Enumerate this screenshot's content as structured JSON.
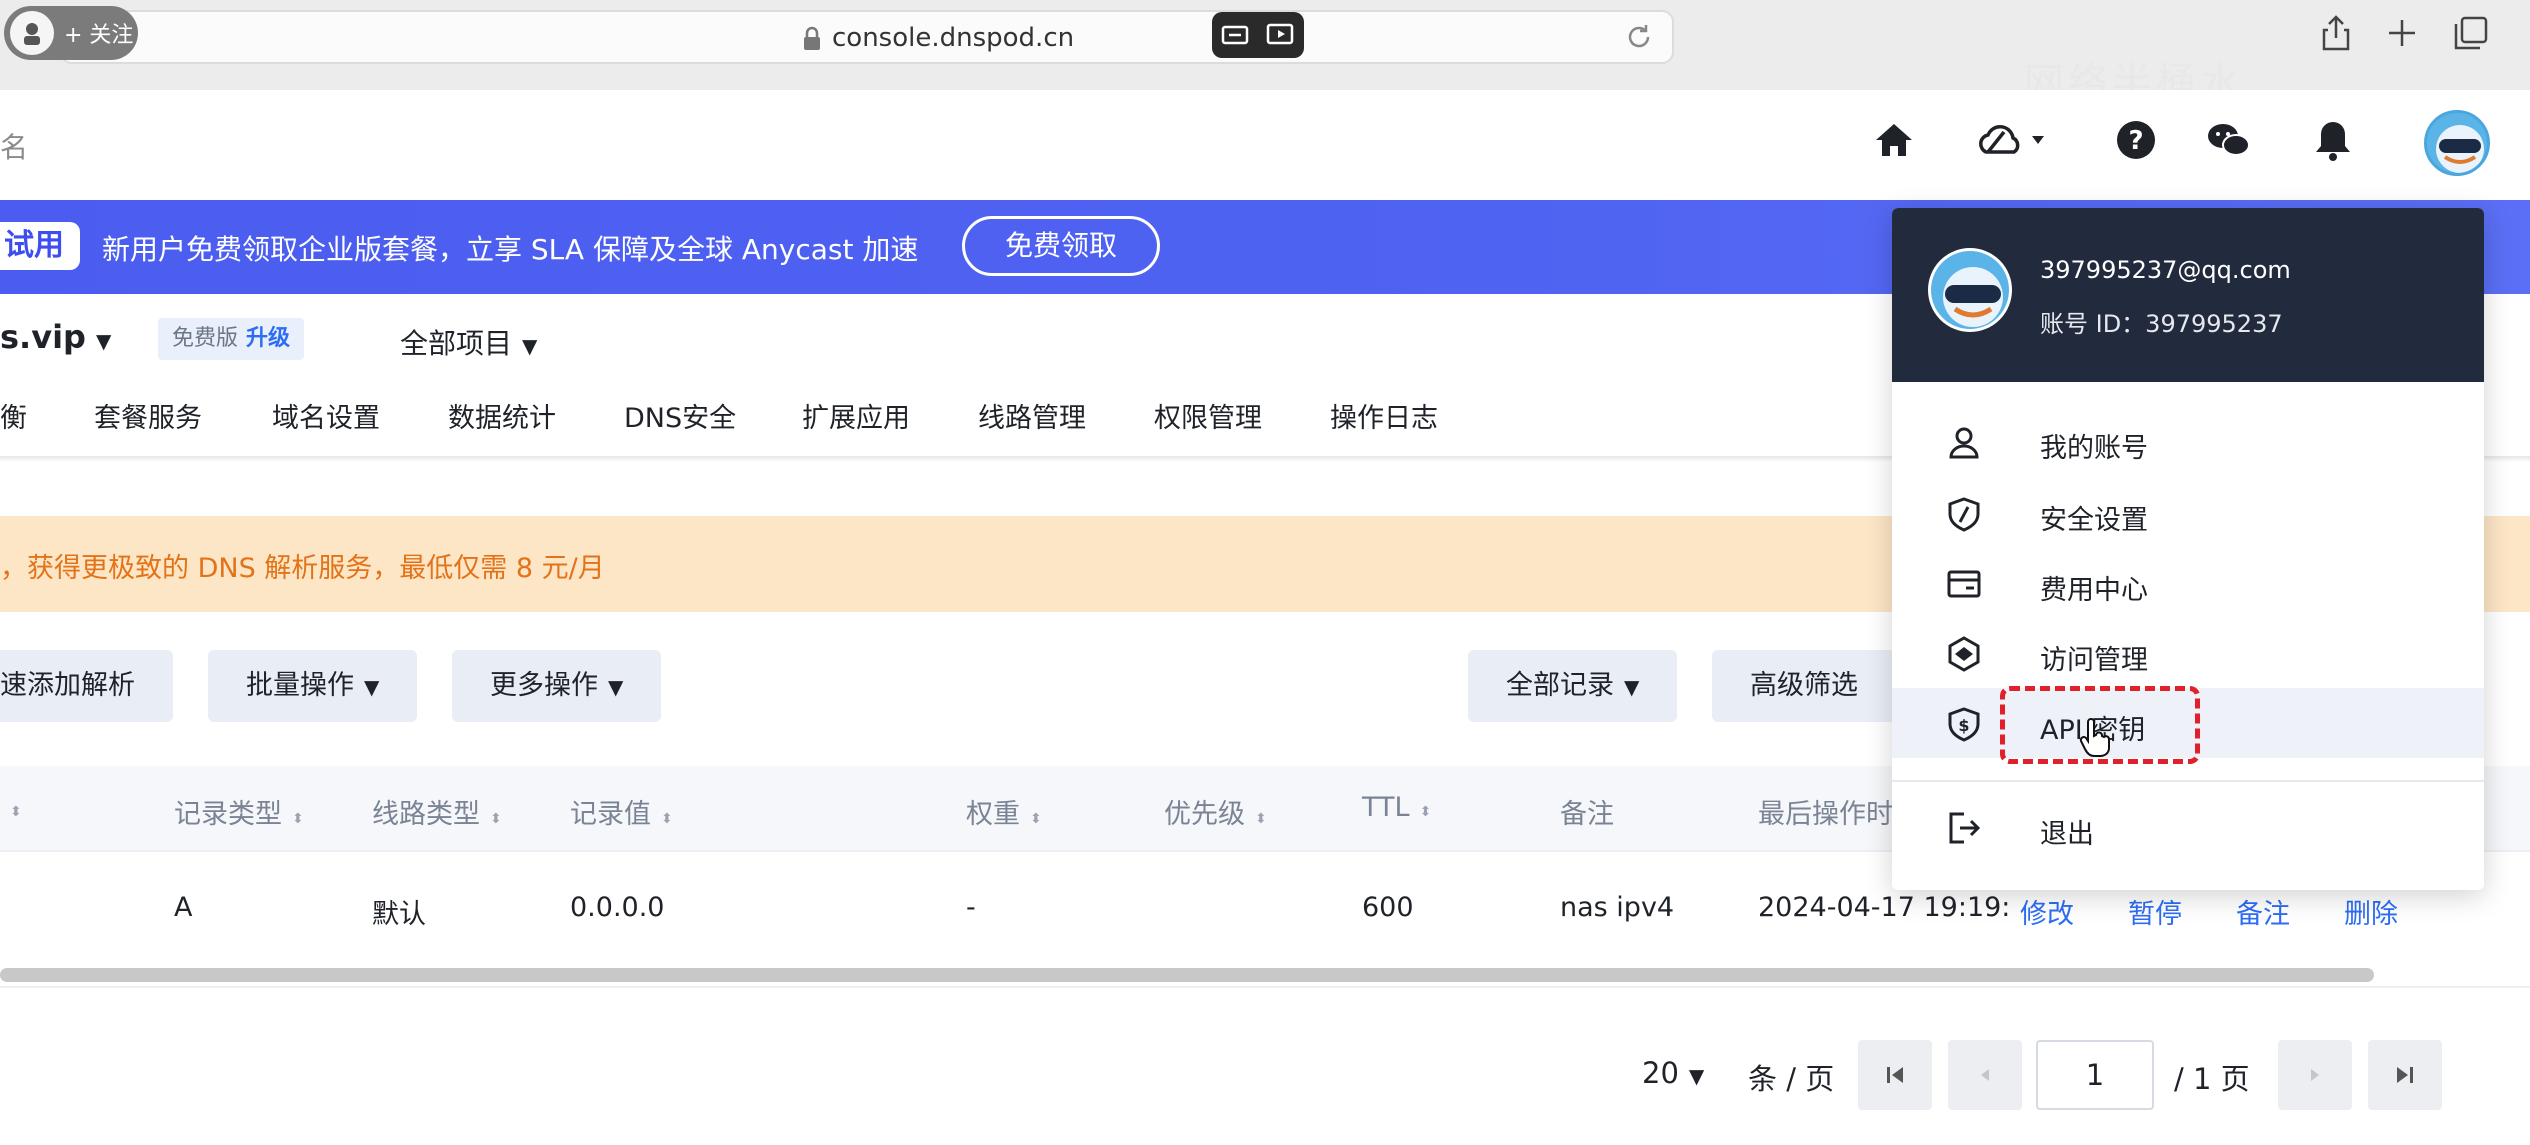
{
  "browser": {
    "follow_label": "+ 关注",
    "url": "console.dnspod.cn",
    "watermark": "网络半桶水"
  },
  "topnav": {
    "left_fragment": "名",
    "icons": [
      "home-icon",
      "cloud-icon",
      "help-icon",
      "wechat-icon",
      "bell-icon"
    ]
  },
  "promo": {
    "tag": "试用",
    "text": "新用户免费领取企业版套餐，立享 SLA 保障及全球 Anycast 加速",
    "button": "免费领取"
  },
  "domain": {
    "name": "s.vip",
    "plan": "免费版",
    "upgrade": "升级",
    "project": "全部项目"
  },
  "tabs": [
    "衡",
    "套餐服务",
    "域名设置",
    "数据统计",
    "DNS安全",
    "扩展应用",
    "线路管理",
    "权限管理",
    "操作日志"
  ],
  "notice": {
    "text": "，获得更极致的 DNS 解析服务，最低仅需 8 元/月"
  },
  "toolbar": {
    "quick_add": "速添加解析",
    "batch": "批量操作",
    "more": "更多操作",
    "all_records": "全部记录",
    "advanced": "高级筛选"
  },
  "table": {
    "headers": {
      "first": "",
      "type": "记录类型",
      "line": "线路类型",
      "value": "记录值",
      "weight": "权重",
      "priority": "优先级",
      "ttl": "TTL",
      "remark": "备注",
      "last_op": "最后操作时"
    },
    "rows": [
      {
        "type": "A",
        "line": "默认",
        "value": "0.0.0.0",
        "weight": "-",
        "ttl": "600",
        "remark": "nas ipv4",
        "last_op": "2024-04-17 19:19:",
        "actions": [
          "修改",
          "暂停",
          "备注",
          "删除"
        ]
      }
    ]
  },
  "pagination": {
    "page_size": "20",
    "per_page_label": "条 / 页",
    "current": "1",
    "total_label": "/ 1 页"
  },
  "user_menu": {
    "email": "397995237@qq.com",
    "account_id": "账号 ID：397995237",
    "items": [
      {
        "label": "我的账号",
        "icon": "user-icon"
      },
      {
        "label": "安全设置",
        "icon": "shield-icon"
      },
      {
        "label": "费用中心",
        "icon": "wallet-icon"
      },
      {
        "label": "访问管理",
        "icon": "access-icon"
      },
      {
        "label": "API 密钥",
        "icon": "key-shield-icon"
      }
    ],
    "logout": "退出"
  },
  "colors": {
    "brand_blue": "#2d6df6",
    "promo_bg": "#4f63f2",
    "notice_bg": "#fde6c6",
    "notice_text": "#e37318",
    "menu_header": "#222a3e",
    "highlight": "#e0202a"
  }
}
